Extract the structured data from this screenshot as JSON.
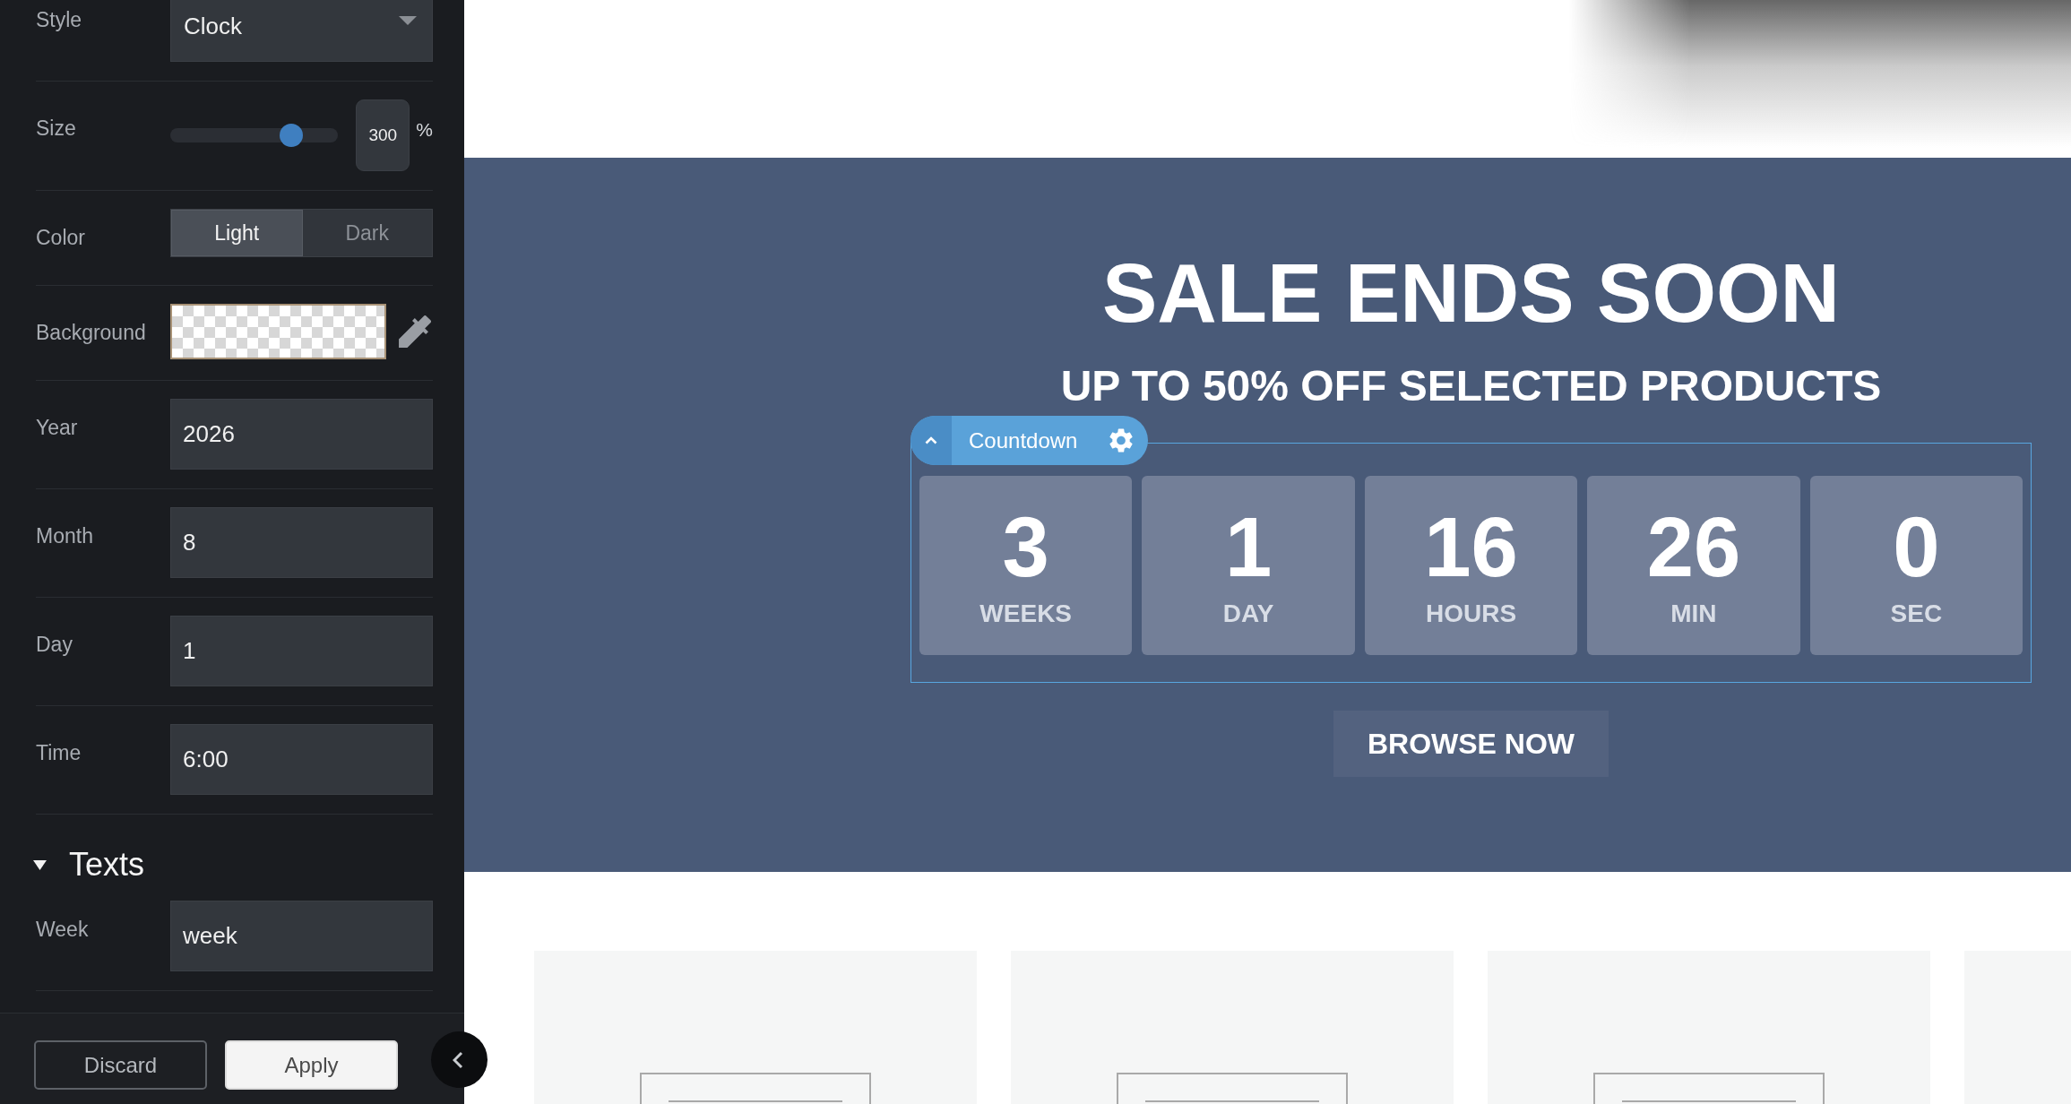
{
  "settings_panel": {
    "fields": [
      {
        "kind": "dropdown",
        "label": "Style",
        "value": "Clock"
      },
      {
        "kind": "slider",
        "label": "Size",
        "level": 0.72,
        "value": "300",
        "unit": "%"
      },
      {
        "kind": "toggle",
        "label": "Color",
        "options": [
          {
            "label": "Light",
            "selected": true
          },
          {
            "label": "Dark",
            "selected": false
          }
        ]
      },
      {
        "kind": "color",
        "label": "Background"
      },
      {
        "kind": "text",
        "label": "Year",
        "value": "2026"
      },
      {
        "kind": "text",
        "label": "Month",
        "value": "8"
      },
      {
        "kind": "text",
        "label": "Day",
        "value": "1"
      },
      {
        "kind": "text",
        "label": "Time",
        "value": "6:00"
      }
    ],
    "sections": [
      {
        "title": "Texts",
        "expanded": true,
        "fields": [
          {
            "kind": "text",
            "label": "Week",
            "value": "week"
          }
        ]
      }
    ],
    "buttons": [
      {
        "label": "Discard",
        "kind": "secondary"
      },
      {
        "label": "Apply",
        "kind": "primary"
      }
    ]
  },
  "preview": {
    "banner": {
      "title": "SALE ENDS SOON",
      "subtitle": "UP TO 50% OFF SELECTED PRODUCTS",
      "countdown_widget": {
        "selected": true,
        "toolbar_label": "Countdown",
        "units": [
          {
            "value": "3",
            "unit": "WEEKS"
          },
          {
            "value": "1",
            "unit": "DAY"
          },
          {
            "value": "16",
            "unit": "HOURS"
          },
          {
            "value": "26",
            "unit": "MIN"
          },
          {
            "value": "0",
            "unit": "SEC"
          }
        ]
      },
      "button": "BROWSE NOW"
    }
  }
}
